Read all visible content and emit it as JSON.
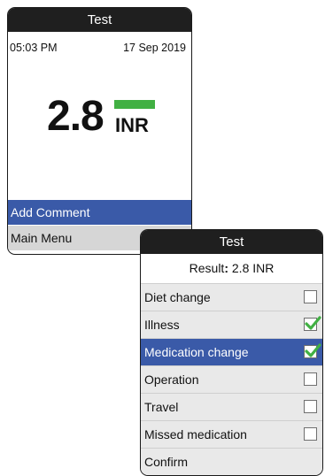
{
  "screen1": {
    "title": "Test",
    "time": "05:03 PM",
    "date": "17 Sep 2019",
    "value": "2.8",
    "unit": "INR",
    "range_status_color": "#41b043",
    "menu": {
      "add_comment": "Add Comment",
      "main_menu": "Main Menu"
    }
  },
  "screen2": {
    "title": "Test",
    "result_label": "Result",
    "result_value": "2.8 INR",
    "options": [
      {
        "label": "Diet change",
        "checked": false,
        "selected": false
      },
      {
        "label": "Illness",
        "checked": true,
        "selected": false
      },
      {
        "label": "Medication change",
        "checked": true,
        "selected": true
      },
      {
        "label": "Operation",
        "checked": false,
        "selected": false
      },
      {
        "label": "Travel",
        "checked": false,
        "selected": false
      },
      {
        "label": "Missed medication",
        "checked": false,
        "selected": false
      }
    ],
    "confirm": "Confirm"
  },
  "colors": {
    "titlebar": "#1f1f1f",
    "accent": "#3a5aa8",
    "check": "#41b043"
  }
}
